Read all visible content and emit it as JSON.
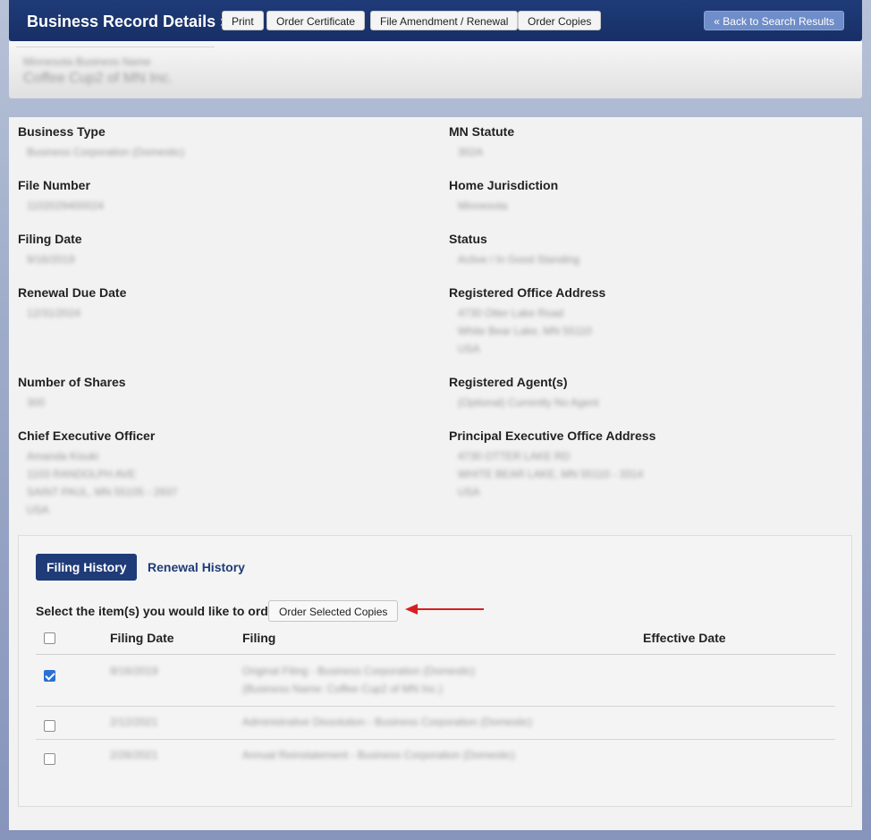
{
  "header": {
    "title": "Business Record Details »",
    "buttons": {
      "print": "Print",
      "order_certificate": "Order Certificate",
      "file_amendment": "File Amendment / Renewal",
      "order_copies": "Order Copies"
    },
    "back": "« Back to Search Results"
  },
  "business": {
    "name_label": "Minnesota Business Name",
    "name": "Coffee Cup2 of MN Inc."
  },
  "fields": {
    "business_type": {
      "label": "Business Type",
      "value": "Business Corporation (Domestic)"
    },
    "mn_statute": {
      "label": "MN Statute",
      "value": "302A"
    },
    "file_number": {
      "label": "File Number",
      "value": "1102029400024"
    },
    "home_jurisdiction": {
      "label": "Home Jurisdiction",
      "value": "Minnesota"
    },
    "filing_date": {
      "label": "Filing Date",
      "value": "9/16/2019"
    },
    "status": {
      "label": "Status",
      "value": "Active / In Good Standing"
    },
    "renewal_due_date": {
      "label": "Renewal Due Date",
      "value": "12/31/2024"
    },
    "registered_office": {
      "label": "Registered Office Address",
      "lines": [
        "4730 Otter Lake Road",
        "White Bear Lake, MN 55110",
        "USA"
      ]
    },
    "number_of_shares": {
      "label": "Number of Shares",
      "value": "300"
    },
    "registered_agents": {
      "label": "Registered Agent(s)",
      "value": "(Optional) Currently No Agent"
    },
    "ceo": {
      "label": "Chief Executive Officer",
      "lines": [
        "Amanda Kisuki",
        "1103 RANDOLPH AVE",
        "SAINT PAUL, MN 55105 - 2937",
        "USA"
      ]
    },
    "principal_office": {
      "label": "Principal Executive Office Address",
      "lines": [
        "4730 OTTER LAKE RD",
        "WHITE BEAR LAKE, MN 55110 - 3314",
        "USA"
      ]
    }
  },
  "history": {
    "tab_filing": "Filing History",
    "tab_renewal": "Renewal History",
    "select_prompt": "Select the item(s) you would like to order:",
    "order_button": "Order Selected Copies",
    "columns": {
      "filing_date": "Filing Date",
      "filing": "Filing",
      "effective_date": "Effective Date"
    },
    "rows": [
      {
        "checked": true,
        "date": "9/16/2019",
        "filing": "Original Filing - Business Corporation (Domestic)",
        "filing_sub": "(Business Name: Coffee Cup2 of MN Inc.)"
      },
      {
        "checked": false,
        "date": "2/12/2021",
        "filing": "Administrative Dissolution - Business Corporation (Domestic)"
      },
      {
        "checked": false,
        "date": "2/26/2021",
        "filing": "Annual Reinstatement - Business Corporation (Domestic)"
      }
    ]
  },
  "colors": {
    "header_bg": "#1f3b78",
    "back_button": "#6f8dc8",
    "arrow": "#d62020",
    "checkbox": "#2a6fd6"
  }
}
